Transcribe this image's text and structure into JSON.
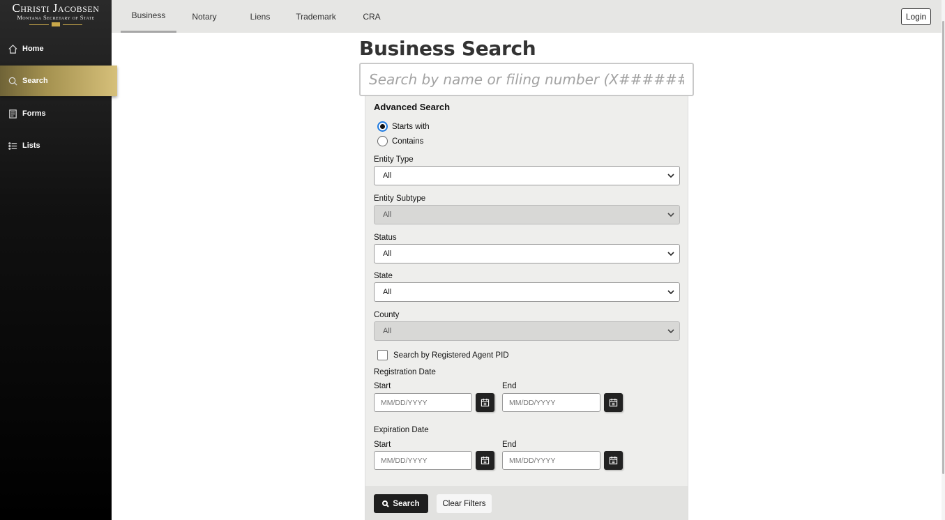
{
  "logo": {
    "name": "Christi Jacobsen",
    "subtitle": "Montana Secretary of State"
  },
  "sidebar": {
    "items": [
      {
        "label": "Home",
        "icon": "home-icon"
      },
      {
        "label": "Search",
        "icon": "search-icon",
        "active": true
      },
      {
        "label": "Forms",
        "icon": "forms-icon"
      },
      {
        "label": "Lists",
        "icon": "list-icon"
      }
    ]
  },
  "tabs": [
    {
      "label": "Business",
      "active": true
    },
    {
      "label": "Notary"
    },
    {
      "label": "Liens"
    },
    {
      "label": "Trademark"
    },
    {
      "label": "CRA"
    }
  ],
  "header": {
    "login_label": "Login"
  },
  "main": {
    "title": "Business Search",
    "search_placeholder": "Search by name or filing number (X########)"
  },
  "advanced": {
    "title": "Advanced Search",
    "match_options": [
      {
        "label": "Starts with",
        "selected": true
      },
      {
        "label": "Contains",
        "selected": false
      }
    ],
    "entity_type": {
      "label": "Entity Type",
      "value": "All"
    },
    "entity_subtype": {
      "label": "Entity Subtype",
      "value": "All",
      "disabled": true
    },
    "status": {
      "label": "Status",
      "value": "All"
    },
    "state": {
      "label": "State",
      "value": "All"
    },
    "county": {
      "label": "County",
      "value": "All",
      "disabled": true
    },
    "registered_agent_checkbox": {
      "label": "Search by Registered Agent PID",
      "checked": false
    },
    "registration_date": {
      "label": "Registration Date",
      "start_label": "Start",
      "start_placeholder": "MM/DD/YYYY",
      "end_label": "End",
      "end_placeholder": "MM/DD/YYYY"
    },
    "expiration_date": {
      "label": "Expiration Date",
      "start_label": "Start",
      "start_placeholder": "MM/DD/YYYY",
      "end_label": "End",
      "end_placeholder": "MM/DD/YYYY"
    },
    "search_button": "Search",
    "clear_button": "Clear Filters"
  },
  "colors": {
    "accent_gold": "#c9a84a",
    "sidebar_bg": "#111111",
    "active_radio": "#1f7ae0"
  }
}
